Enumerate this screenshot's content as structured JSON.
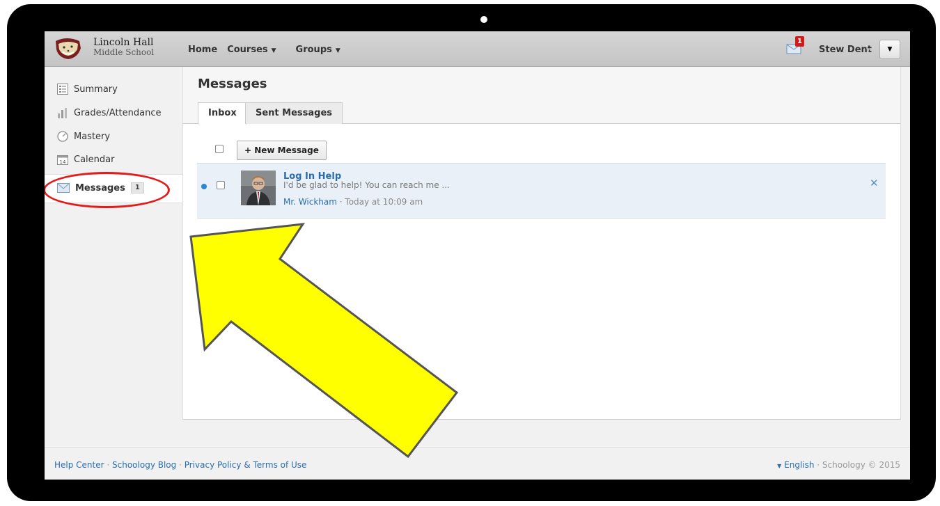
{
  "school": {
    "name_line1": "Lincoln Hall",
    "name_line2": "Middle School"
  },
  "topnav": {
    "home": "Home",
    "courses": "Courses",
    "groups": "Groups"
  },
  "header": {
    "mail_count": "1",
    "user_name": "Stew Dent"
  },
  "sidebar": {
    "items": [
      {
        "label": "Summary"
      },
      {
        "label": "Grades/Attendance"
      },
      {
        "label": "Mastery"
      },
      {
        "label": "Calendar"
      },
      {
        "label": "Messages",
        "badge": "1"
      }
    ],
    "calendar_day": "14"
  },
  "main": {
    "title": "Messages",
    "tabs": [
      {
        "label": "Inbox"
      },
      {
        "label": "Sent Messages"
      }
    ],
    "new_message_label": "+ New Message",
    "messages": [
      {
        "subject": "Log In Help",
        "preview": "I'd be glad to help! You can reach me ...",
        "sender": "Mr. Wickham",
        "time": "· Today at 10:09 am",
        "unread": true
      }
    ]
  },
  "footer": {
    "help_center": "Help Center",
    "blog": "Schoology Blog",
    "privacy": "Privacy Policy & Terms of Use",
    "language": "English",
    "copyright": "Schoology © 2015"
  },
  "colors": {
    "link": "#2a6dad",
    "arrow_fill": "#ffff00",
    "highlight_ring": "#e31b1b",
    "unread": "#2b86d6"
  }
}
